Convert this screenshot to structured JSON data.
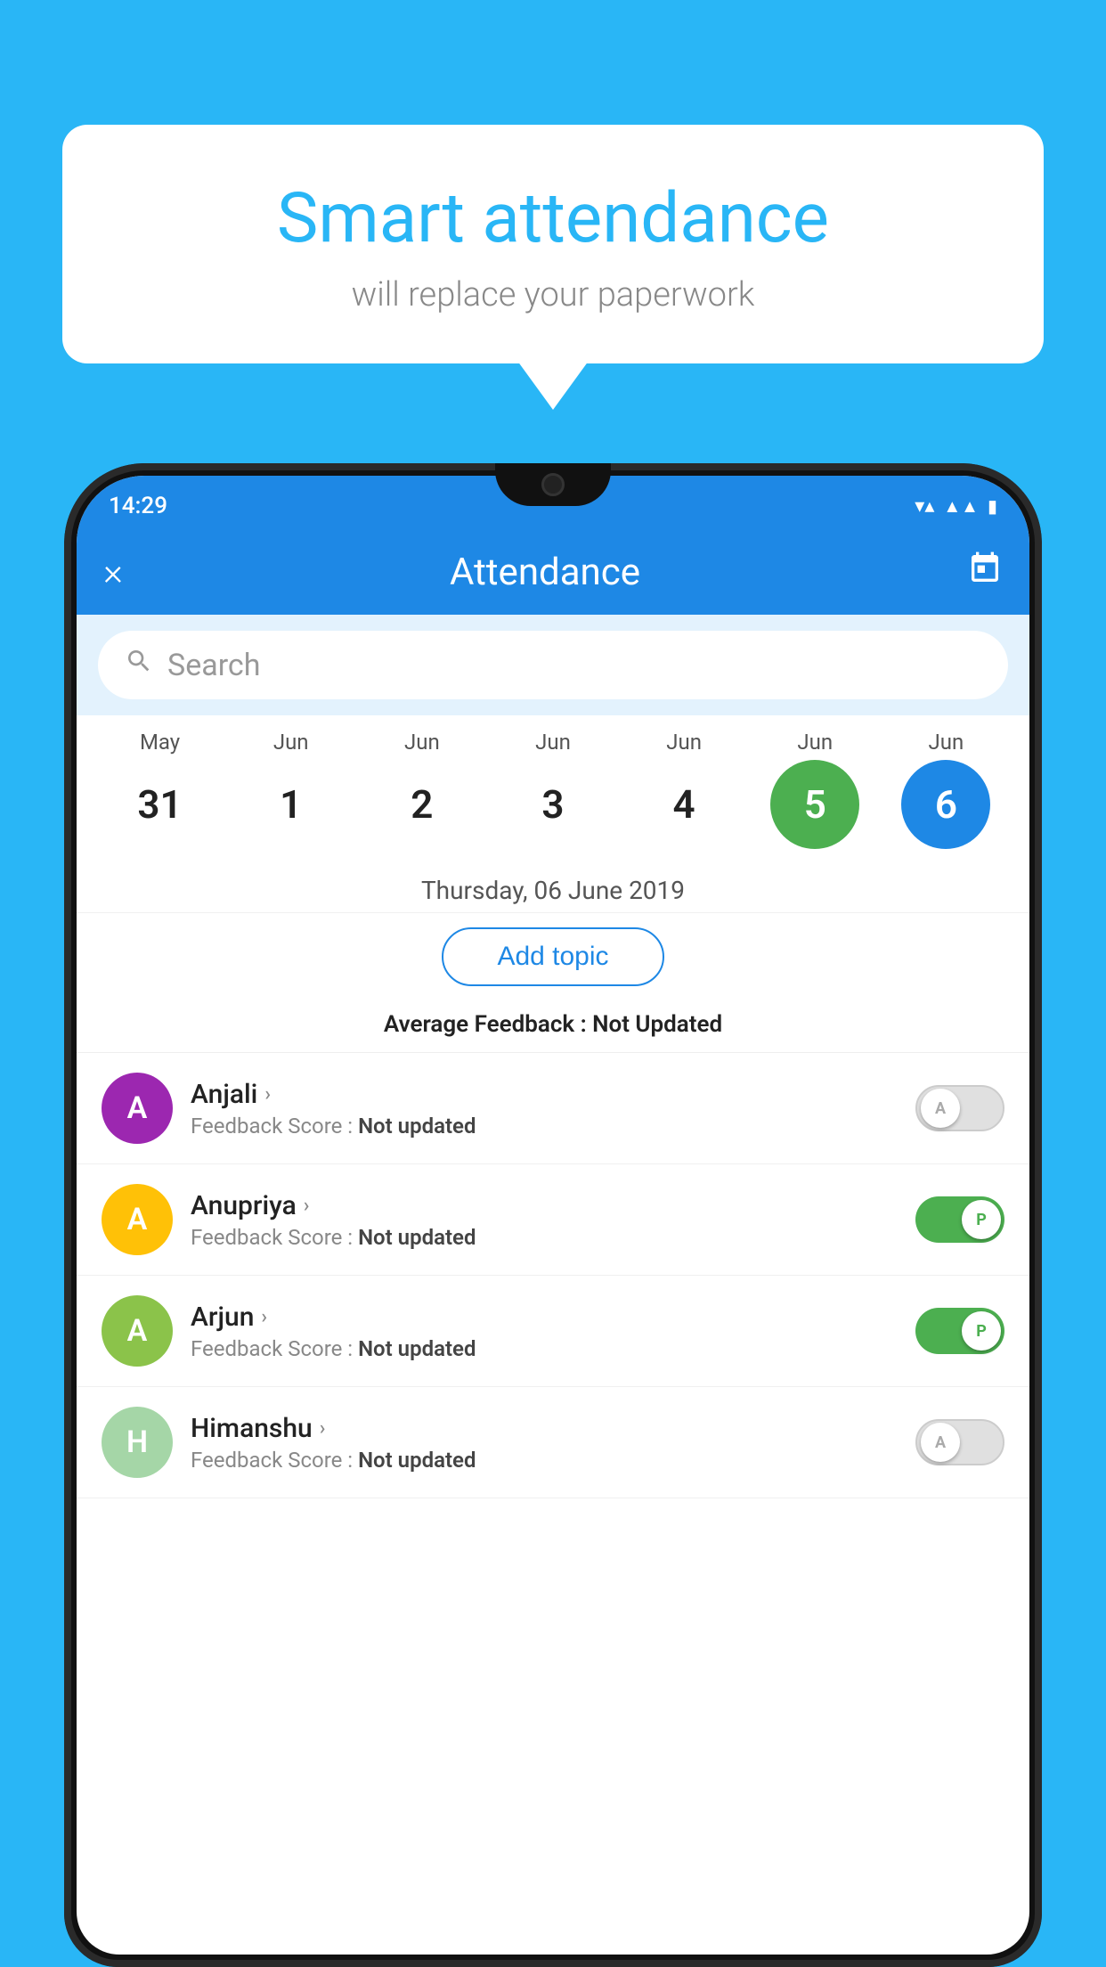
{
  "background": {
    "color": "#29b6f6"
  },
  "speech_bubble": {
    "title": "Smart attendance",
    "subtitle": "will replace your paperwork"
  },
  "status_bar": {
    "time": "14:29",
    "wifi": "▼▲",
    "battery": "▮"
  },
  "app_bar": {
    "title": "Attendance",
    "close_label": "×",
    "calendar_icon": "📅"
  },
  "search": {
    "placeholder": "Search"
  },
  "calendar": {
    "dates": [
      {
        "month": "May",
        "day": "31",
        "state": "normal"
      },
      {
        "month": "Jun",
        "day": "1",
        "state": "normal"
      },
      {
        "month": "Jun",
        "day": "2",
        "state": "normal"
      },
      {
        "month": "Jun",
        "day": "3",
        "state": "normal"
      },
      {
        "month": "Jun",
        "day": "4",
        "state": "normal"
      },
      {
        "month": "Jun",
        "day": "5",
        "state": "today"
      },
      {
        "month": "Jun",
        "day": "6",
        "state": "selected"
      }
    ],
    "selected_date_label": "Thursday, 06 June 2019"
  },
  "add_topic": {
    "label": "Add topic"
  },
  "avg_feedback": {
    "label": "Average Feedback :",
    "value": "Not Updated"
  },
  "students": [
    {
      "name": "Anjali",
      "avatar_letter": "A",
      "avatar_color": "#9c27b0",
      "feedback_label": "Feedback Score :",
      "feedback_value": "Not updated",
      "toggle": "off",
      "toggle_letter": "A"
    },
    {
      "name": "Anupriya",
      "avatar_letter": "A",
      "avatar_color": "#ffc107",
      "feedback_label": "Feedback Score :",
      "feedback_value": "Not updated",
      "toggle": "on",
      "toggle_letter": "P"
    },
    {
      "name": "Arjun",
      "avatar_letter": "A",
      "avatar_color": "#8bc34a",
      "feedback_label": "Feedback Score :",
      "feedback_value": "Not updated",
      "toggle": "on",
      "toggle_letter": "P"
    },
    {
      "name": "Himanshu",
      "avatar_letter": "H",
      "avatar_color": "#a5d6a7",
      "feedback_label": "Feedback Score :",
      "feedback_value": "Not updated",
      "toggle": "off",
      "toggle_letter": "A"
    }
  ]
}
